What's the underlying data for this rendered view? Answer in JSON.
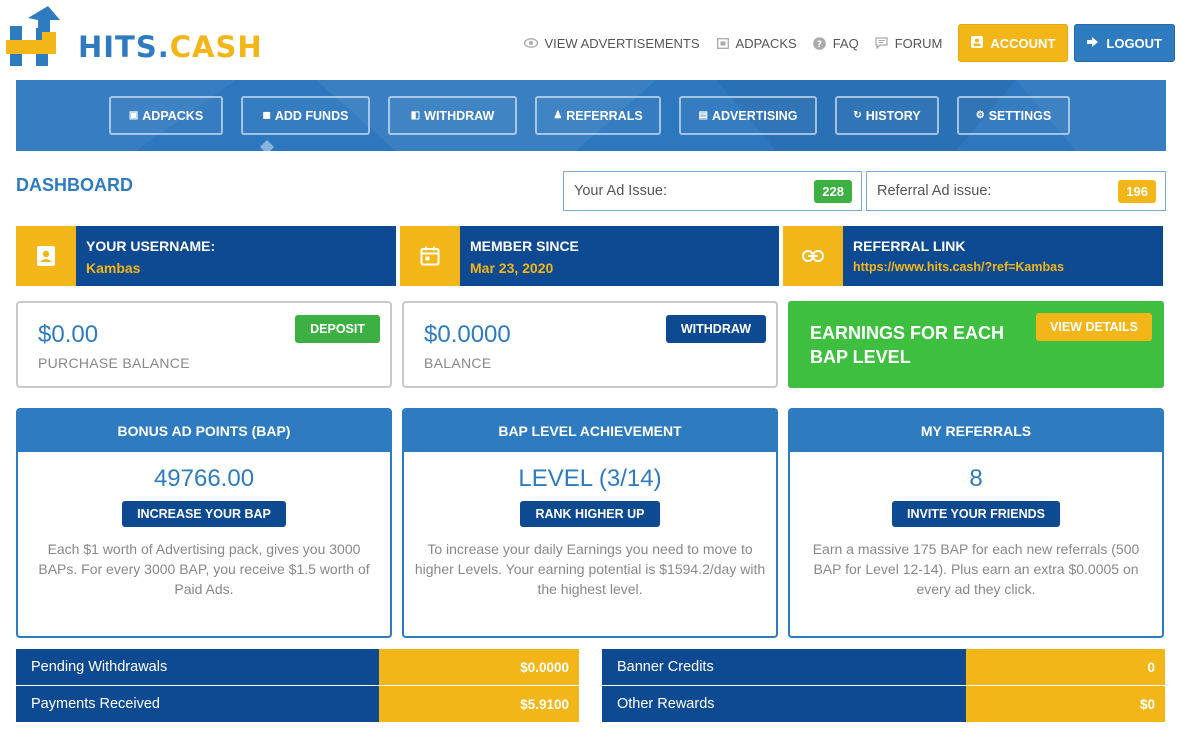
{
  "header": {
    "logo_text_a": "HITS.",
    "logo_text_b": "CASH",
    "nav": [
      {
        "label": "VIEW ADVERTISEMENTS",
        "icon": "eye-icon"
      },
      {
        "label": "ADPACKS",
        "icon": "adpack-icon"
      },
      {
        "label": "FAQ",
        "icon": "question-icon"
      },
      {
        "label": "FORUM",
        "icon": "chat-icon"
      }
    ],
    "account_label": "ACCOUNT",
    "logout_label": "LOGOUT"
  },
  "menu": [
    {
      "label": "ADPACKS",
      "icon": "adpack-icon"
    },
    {
      "label": "ADD FUNDS",
      "icon": "bag-icon"
    },
    {
      "label": "WITHDRAW",
      "icon": "withdraw-icon"
    },
    {
      "label": "REFERRALS",
      "icon": "users-icon"
    },
    {
      "label": "ADVERTISING",
      "icon": "ad-icon"
    },
    {
      "label": "HISTORY",
      "icon": "history-icon"
    },
    {
      "label": "SETTINGS",
      "icon": "gear-icon"
    }
  ],
  "dashboard": {
    "title": "DASHBOARD",
    "ad_issue_label": "Your Ad Issue:",
    "ad_issue_value": "228",
    "ref_issue_label": "Referral Ad issue:",
    "ref_issue_value": "196"
  },
  "info": {
    "username_title": "YOUR USERNAME:",
    "username_value": "Kambas",
    "member_title": "MEMBER SINCE",
    "member_value": "Mar 23, 2020",
    "referral_title": "REFERRAL LINK",
    "referral_value": "https://www.hits.cash/?ref=Kambas"
  },
  "balances": {
    "purchase_amount": "$0.00",
    "purchase_label": "PURCHASE BALANCE",
    "deposit_label": "DEPOSIT",
    "balance_amount": "$0.0000",
    "balance_label": "BALANCE",
    "withdraw_label": "WITHDRAW",
    "earnings_title": "EARNINGS FOR EACH BAP LEVEL",
    "view_details_label": "VIEW DETAILS"
  },
  "stats": {
    "bap_title": "BONUS AD POINTS (BAP)",
    "bap_value": "49766.00",
    "bap_button": "INCREASE YOUR BAP",
    "bap_desc": "Each $1 worth of Advertising pack, gives you 3000 BAPs. For every 3000 BAP, you receive $1.5 worth of Paid Ads.",
    "level_title": "BAP LEVEL ACHIEVEMENT",
    "level_value": "LEVEL (3/14)",
    "level_button": "RANK HIGHER UP",
    "level_desc": "To increase your daily Earnings you need to move to higher Levels. Your earning potential is $1594.2/day with the highest level.",
    "ref_title": "MY REFERRALS",
    "ref_value": "8",
    "ref_button": "INVITE YOUR FRIENDS",
    "ref_desc": "Earn a massive 175 BAP for each new referrals (500 BAP for Level 12-14). Plus earn an extra $0.0005 on every ad they click."
  },
  "summary": {
    "pending_label": "Pending Withdrawals",
    "pending_value": "$0.0000",
    "payments_label": "Payments Received",
    "payments_value": "$5.9100",
    "banner_label": "Banner Credits",
    "banner_value": "0",
    "other_label": "Other Rewards",
    "other_value": "$0"
  },
  "colors": {
    "blue": "#2f7bbf",
    "navy": "#0e4a91",
    "yellow": "#f2b618",
    "green": "#3fbf3f"
  }
}
